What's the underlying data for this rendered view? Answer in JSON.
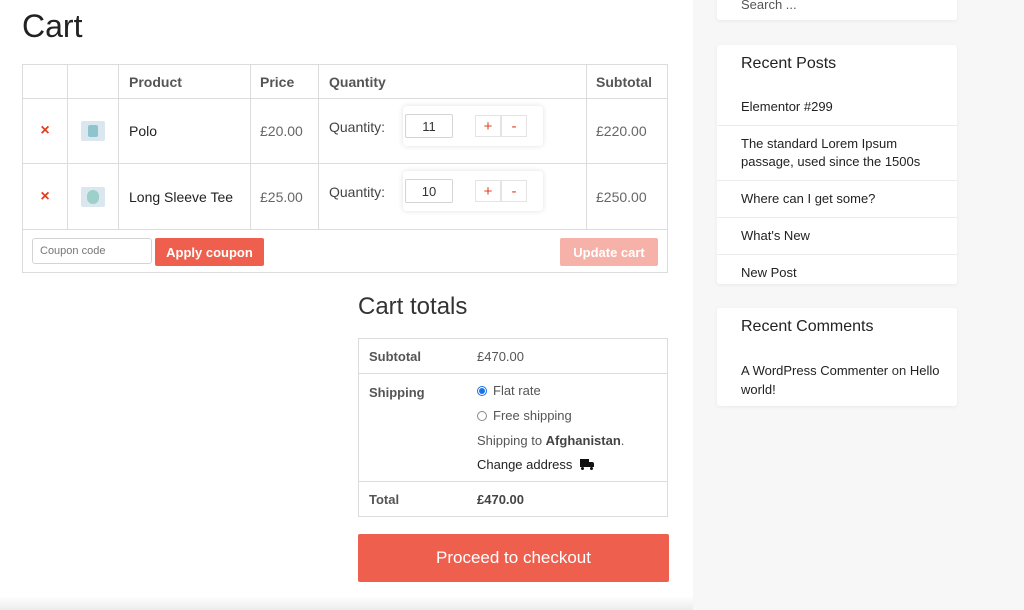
{
  "page": {
    "title": "Cart"
  },
  "cart_table": {
    "headers": {
      "product": "Product",
      "price": "Price",
      "quantity": "Quantity",
      "subtotal": "Subtotal"
    },
    "remove_symbol": "×",
    "items": [
      {
        "name": "Polo",
        "price": "£20.00",
        "qty_label": "Quantity:",
        "qty": "11",
        "subtotal": "£220.00"
      },
      {
        "name": "Long Sleeve Tee",
        "price": "£25.00",
        "qty_label": "Quantity:",
        "qty": "10",
        "subtotal": "£250.00"
      }
    ],
    "plus": "+",
    "minus": "-"
  },
  "coupon": {
    "placeholder": "Coupon code",
    "apply_label": "Apply coupon"
  },
  "update_label": "Update cart",
  "totals": {
    "title": "Cart totals",
    "subtotal_label": "Subtotal",
    "subtotal_value": "£470.00",
    "shipping_label": "Shipping",
    "options": [
      {
        "label": "Flat rate",
        "selected": true
      },
      {
        "label": "Free shipping",
        "selected": false
      }
    ],
    "ship_to_prefix": "Shipping to ",
    "ship_to_country": "Afghanistan",
    "ship_to_suffix": ".",
    "change_address": "Change address",
    "total_label": "Total",
    "total_value": "£470.00"
  },
  "checkout_label": "Proceed to checkout",
  "sidebar": {
    "search_placeholder": "Search ...",
    "recent_posts_title": "Recent Posts",
    "posts": [
      "Elementor #299",
      "The standard Lorem Ipsum passage, used since the 1500s",
      "Where can I get some?",
      "What's New",
      "New Post"
    ],
    "recent_comments_title": "Recent Comments",
    "comment_author": "A WordPress Commenter",
    "comment_on": " on ",
    "comment_post": "Hello world!"
  },
  "colors": {
    "accent": "#ee604d",
    "accent_disabled": "#f6b2a8",
    "remove": "#e2401c",
    "radio": "#1a73e8"
  },
  "icons": {
    "remove": "close-icon",
    "truck": "truck-icon"
  }
}
